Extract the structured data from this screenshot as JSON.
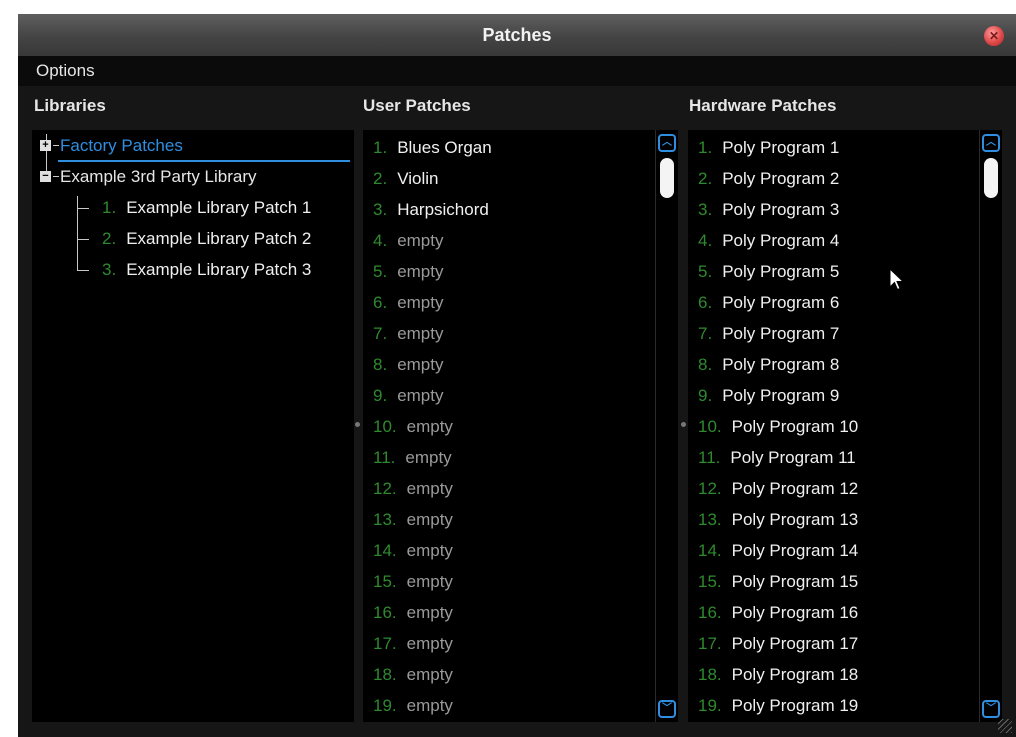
{
  "window": {
    "title": "Patches"
  },
  "menu": {
    "options": "Options"
  },
  "columns": {
    "libraries": "Libraries",
    "user_patches": "User Patches",
    "hardware_patches": "Hardware Patches"
  },
  "libraries": {
    "factory": {
      "label": "Factory Patches",
      "expander": "+"
    },
    "third_party": {
      "label": "Example 3rd Party Library",
      "expander": "−",
      "children": [
        {
          "num": "1.",
          "name": "Example Library Patch 1"
        },
        {
          "num": "2.",
          "name": "Example Library Patch 2"
        },
        {
          "num": "3.",
          "name": "Example Library Patch 3"
        }
      ]
    }
  },
  "user_patches": [
    {
      "num": "1.",
      "name": "Blues Organ"
    },
    {
      "num": "2.",
      "name": "Violin"
    },
    {
      "num": "3.",
      "name": "Harpsichord"
    },
    {
      "num": "4.",
      "name": "empty"
    },
    {
      "num": "5.",
      "name": "empty"
    },
    {
      "num": "6.",
      "name": "empty"
    },
    {
      "num": "7.",
      "name": "empty"
    },
    {
      "num": "8.",
      "name": "empty"
    },
    {
      "num": "9.",
      "name": "empty"
    },
    {
      "num": "10.",
      "name": "empty"
    },
    {
      "num": "11.",
      "name": "empty"
    },
    {
      "num": "12.",
      "name": "empty"
    },
    {
      "num": "13.",
      "name": "empty"
    },
    {
      "num": "14.",
      "name": "empty"
    },
    {
      "num": "15.",
      "name": "empty"
    },
    {
      "num": "16.",
      "name": "empty"
    },
    {
      "num": "17.",
      "name": "empty"
    },
    {
      "num": "18.",
      "name": "empty"
    },
    {
      "num": "19.",
      "name": "empty"
    }
  ],
  "hardware_patches": [
    {
      "num": "1.",
      "name": "Poly Program 1"
    },
    {
      "num": "2.",
      "name": "Poly Program 2"
    },
    {
      "num": "3.",
      "name": "Poly Program 3"
    },
    {
      "num": "4.",
      "name": "Poly Program 4"
    },
    {
      "num": "5.",
      "name": "Poly Program 5"
    },
    {
      "num": "6.",
      "name": "Poly Program 6"
    },
    {
      "num": "7.",
      "name": "Poly Program 7"
    },
    {
      "num": "8.",
      "name": "Poly Program 8"
    },
    {
      "num": "9.",
      "name": "Poly Program 9"
    },
    {
      "num": "10.",
      "name": "Poly Program 10"
    },
    {
      "num": "11.",
      "name": "Poly Program 11"
    },
    {
      "num": "12.",
      "name": "Poly Program 12"
    },
    {
      "num": "13.",
      "name": "Poly Program 13"
    },
    {
      "num": "14.",
      "name": "Poly Program 14"
    },
    {
      "num": "15.",
      "name": "Poly Program 15"
    },
    {
      "num": "16.",
      "name": "Poly Program 16"
    },
    {
      "num": "17.",
      "name": "Poly Program 17"
    },
    {
      "num": "18.",
      "name": "Poly Program 18"
    },
    {
      "num": "19.",
      "name": "Poly Program 19"
    }
  ],
  "icons": {
    "close": "close-icon",
    "scroll_up": "chevron-up-icon",
    "scroll_down": "chevron-down-icon",
    "cursor": "mouse-pointer-icon",
    "resize": "resize-grip-icon"
  },
  "colors": {
    "accent": "#2f8ee0",
    "number_green": "#2f8a2f",
    "empty_gray": "#9a9a9a",
    "background": "#000000"
  }
}
